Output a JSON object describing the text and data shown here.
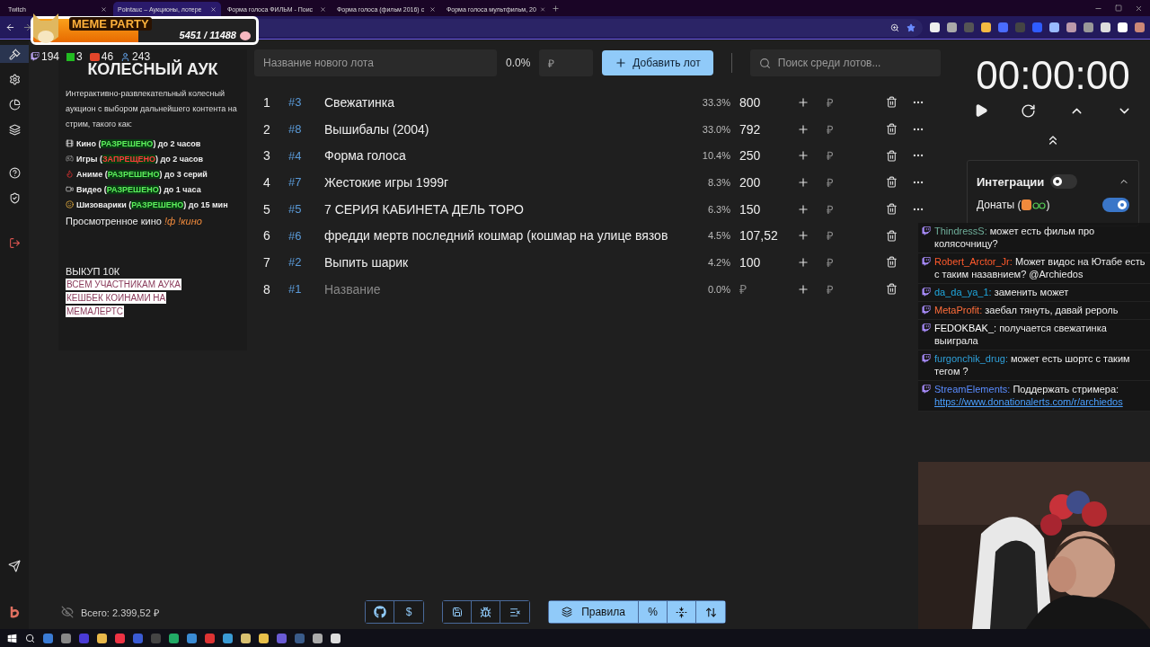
{
  "browser": {
    "tabs": [
      {
        "title": "Twitch",
        "selected": false
      },
      {
        "title": "Pointauc – Аукционы, лотере",
        "selected": true
      },
      {
        "title": "Форма голоса ФИЛЬМ - Поис",
        "selected": false
      },
      {
        "title": "Форма голоса (фильм 2016) с",
        "selected": false
      },
      {
        "title": "Форма голоса мультфильм, 20",
        "selected": false
      }
    ]
  },
  "sidebar": {
    "items": [
      {
        "selected": true
      },
      {
        "selected": false
      },
      {
        "selected": false
      },
      {
        "selected": false
      },
      {
        "selected": false
      },
      {
        "selected": false
      },
      {
        "selected": false
      }
    ]
  },
  "info": {
    "title": "КОЛЕСНЫЙ АУК",
    "description": "Интерактивно-развлекательный колесный аукцион с выбором дальнейшего контента на стрим, такого как:",
    "rules": [
      {
        "before": "Кино (",
        "status": "РАЗРЕШЕНО",
        "allowed": true,
        "after": ") до 2 часов"
      },
      {
        "before": "Игры (",
        "status": "ЗАПРЕЩЕНО",
        "allowed": false,
        "after": ") до 2 часов"
      },
      {
        "before": "Аниме (",
        "status": "РАЗРЕШЕНО",
        "allowed": true,
        "after": ") до 3 серий"
      },
      {
        "before": "Видео (",
        "status": "РАЗРЕШЕНО",
        "allowed": true,
        "after": ") до 1 часа"
      },
      {
        "before": "Шизоварики (",
        "status": "РАЗРЕШЕНО",
        "allowed": true,
        "after": ") до 15 мин"
      }
    ],
    "watched": "Просмотренное кино",
    "commands": "!ф !кино",
    "buyout": "ВЫКУП 10К",
    "highlight": [
      "ВСЕМ УЧАСТНИКАМ АУКА",
      "КЕШБЕК КОИНАМИ НА",
      "МЕМАЛЕРТС"
    ]
  },
  "new_lot": {
    "placeholder": "Название нового лота",
    "percent": "0.0%",
    "amount_placeholder": "₽",
    "add_button": "Добавить лот",
    "search_placeholder": "Поиск среди лотов..."
  },
  "lots": [
    {
      "index": "1",
      "id": "3",
      "name": "Свежатинка",
      "percent": "33.3%",
      "amount": "800"
    },
    {
      "index": "2",
      "id": "8",
      "name": "Вышибалы (2004)",
      "percent": "33.0%",
      "amount": "792"
    },
    {
      "index": "3",
      "id": "4",
      "name": "Форма голоса",
      "percent": "10.4%",
      "amount": "250"
    },
    {
      "index": "4",
      "id": "7",
      "name": "Жестокие игры 1999г",
      "percent": "8.3%",
      "amount": "200"
    },
    {
      "index": "5",
      "id": "5",
      "name": "7 СЕРИЯ КАБИНЕТА ДЕЛЬ ТОРО",
      "percent": "6.3%",
      "amount": "150"
    },
    {
      "index": "6",
      "id": "6",
      "name": "фредди мертв последний кошмар (кошмар на улице вязов",
      "percent": "4.5%",
      "amount": "107,52"
    },
    {
      "index": "7",
      "id": "2",
      "name": "Выпить шарик",
      "percent": "4.2%",
      "amount": "100"
    },
    {
      "index": "8",
      "id": "1",
      "name_placeholder": "Название",
      "percent": "0.0%",
      "amount_placeholder": "₽"
    }
  ],
  "currency": "₽",
  "id_mark": "#",
  "timer": {
    "time": "00:00:00"
  },
  "integrations": {
    "title": "Интеграции",
    "on": false,
    "donations": {
      "label": "Донаты (",
      "close": ")",
      "on": true
    }
  },
  "bottom": {
    "total": "Всего: 2.399,52 ₽",
    "dollar": "$",
    "rules": {
      "label": "Правила",
      "selected": true
    },
    "percent": "%"
  },
  "overlay": {
    "title": "MEME PARTY",
    "progress": "5451 / 11488",
    "level": 0.47,
    "stats": [
      "194",
      "3",
      "46",
      "243"
    ]
  },
  "chat": [
    {
      "user": "ThindressS:",
      "color": "#6fae9a",
      "text": "может есть фильм про колясочницу?"
    },
    {
      "user": "Robert_Arctor_Jr:",
      "color": "#ff5a2c",
      "text": "Может видос на Ютабе есть с таким назавнием? @Archiedos"
    },
    {
      "user": "da_da_ya_1:",
      "color": "#1fa8e0",
      "text": "заменить может"
    },
    {
      "user": "MetaProfit:",
      "color": "#ff6d3a",
      "text": "заебал тянуть, давай рероль"
    },
    {
      "user": "FEDOKBAK_:",
      "color": "#ffffff",
      "text": "получается свежатинка выиграла"
    },
    {
      "user": "furgonchik_drug:",
      "color": "#2e9fd8",
      "text": "может есть шортс с таким тегом ?"
    },
    {
      "user": "StreamElements:",
      "color": "#5a8cff",
      "text": "Поддержать стримера:",
      "link": "https://www.donationalerts.com/r/archiedos"
    }
  ]
}
